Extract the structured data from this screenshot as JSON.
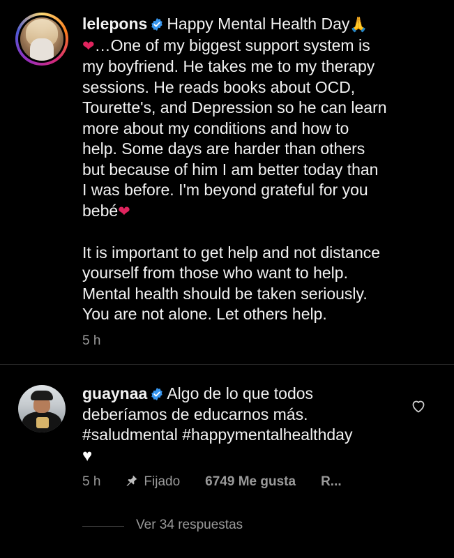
{
  "post": {
    "username": "lelepons",
    "caption_lines": [
      "Happy Mental Health Day",
      "…One of my biggest support system is",
      "my boyfriend. He takes me to my therapy",
      "sessions. He reads books about OCD,",
      "Tourette's, and Depression so he can learn",
      "more about my conditions and how to",
      "help. Some days are harder than others",
      "but because of him I am better today than",
      "I was before. I'm beyond grateful for you",
      "bebé",
      "It is important to get help and not distance",
      "yourself from those who want to help.",
      "Mental health should be taken seriously.",
      "You are not alone. Let others help."
    ],
    "time": "5 h"
  },
  "comment": {
    "username": "guaynaa",
    "text_lines": [
      "Algo de lo que todos",
      "deberíamos de educarnos más.",
      "#saludmental #happymentalhealthday"
    ],
    "time": "5 h",
    "pinned_label": "Fijado",
    "likes_label": "6749 Me gusta",
    "reply_label": "R...",
    "view_replies": "Ver 34 respuestas"
  },
  "icons": {
    "verified": "verified-badge-icon",
    "like": "heart-outline-icon",
    "pin": "pin-icon"
  },
  "colors": {
    "background": "#000000",
    "text": "#f2f2f2",
    "meta": "#9a9a9a",
    "verified": "#3897f0",
    "heart_red": "#e0245e"
  }
}
